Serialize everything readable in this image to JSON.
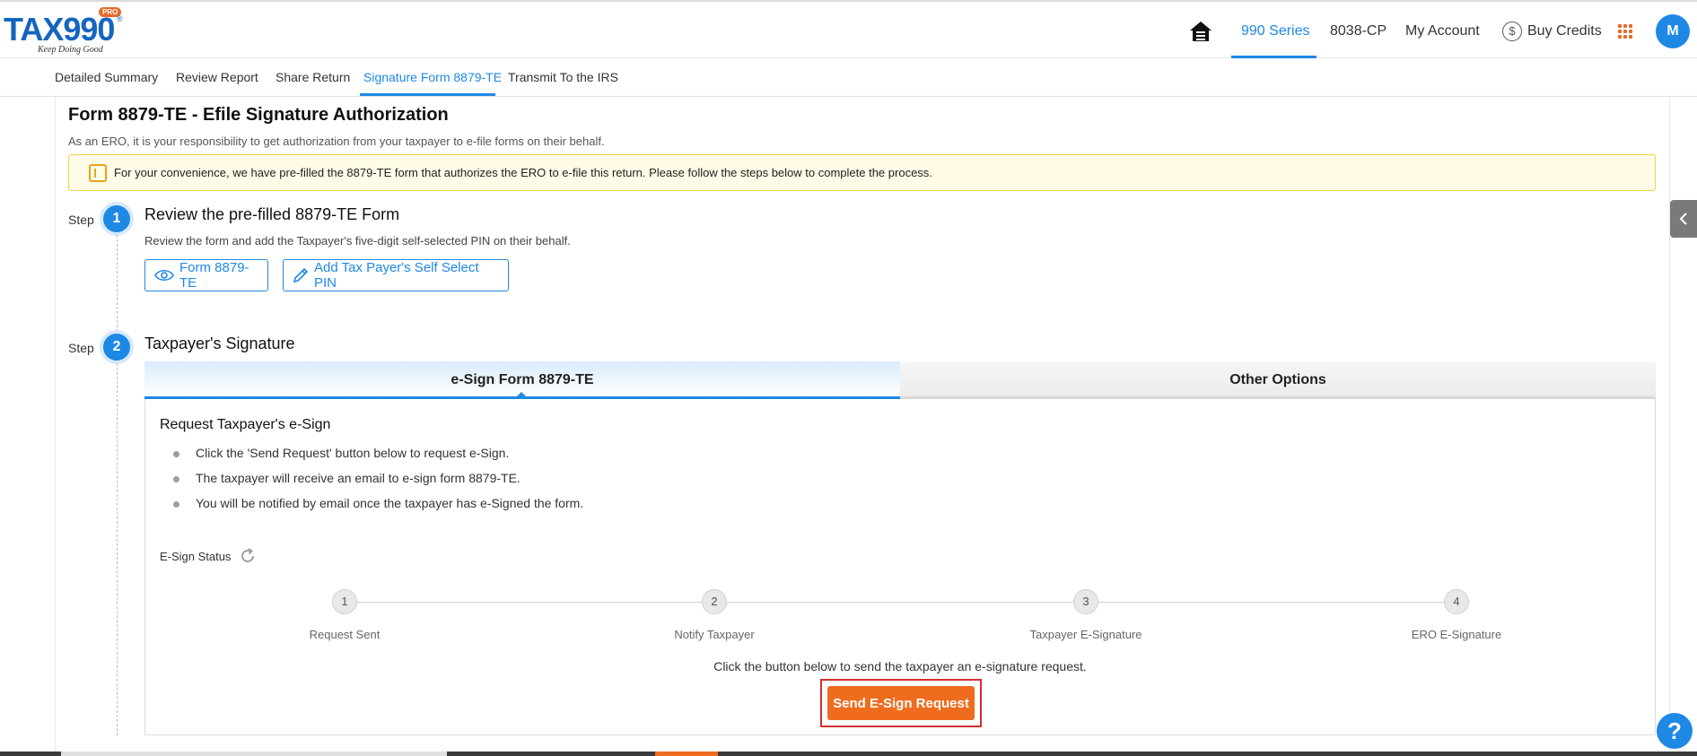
{
  "header": {
    "logo": {
      "brand": "TAX990",
      "badge": "PRO",
      "tagline": "Keep Doing Good",
      "registered": "®"
    },
    "nav": {
      "series": "990 Series",
      "cp": "8038-CP",
      "account": "My Account",
      "credits": "Buy Credits",
      "avatar_initial": "M"
    },
    "dollar_symbol": "$"
  },
  "subtabs": {
    "detailed_summary": "Detailed Summary",
    "review_report": "Review Report",
    "share_return": "Share Return",
    "signature_form": "Signature Form 8879-TE",
    "transmit": "Transmit To the IRS"
  },
  "page": {
    "title": "Form 8879-TE - Efile Signature Authorization",
    "subtitle": "As an ERO, it is your responsibility to get authorization from your taxpayer to e-file forms on their behalf.",
    "notice": "For your convenience, we have pre-filled the 8879-TE form that authorizes the ERO to e-file this return. Please follow the steps below to complete the process."
  },
  "step1": {
    "label": "Step",
    "number": "1",
    "title": "Review the pre-filled 8879-TE Form",
    "description": "Review the form and add the Taxpayer's five-digit self-selected PIN on their behalf.",
    "form_button": "Form 8879-TE",
    "pin_button": "Add Tax Payer's Self Select PIN"
  },
  "step2": {
    "label": "Step",
    "number": "2",
    "title": "Taxpayer's Signature",
    "tabs": {
      "esign": "e-Sign Form 8879-TE",
      "other": "Other Options"
    },
    "panel": {
      "title": "Request Taxpayer's e-Sign",
      "bullets": [
        "Click the 'Send Request' button below to request e-Sign.",
        "The taxpayer will receive an email to e-sign form 8879-TE.",
        "You will be notified by email once the taxpayer has e-Signed the form."
      ],
      "status_label": "E-Sign Status",
      "progress": [
        {
          "number": "1",
          "label": "Request Sent"
        },
        {
          "number": "2",
          "label": "Notify Taxpayer"
        },
        {
          "number": "3",
          "label": "Taxpayer E-Signature"
        },
        {
          "number": "4",
          "label": "ERO E-Signature"
        }
      ],
      "hint": "Click the button below to send the taxpayer an e-signature request.",
      "send_button": "Send E-Sign Request"
    }
  },
  "help": "?",
  "colors": {
    "accent": "#1e88e5",
    "brand_orange": "#ef6c1f",
    "notice_bg": "#fffbe6"
  }
}
